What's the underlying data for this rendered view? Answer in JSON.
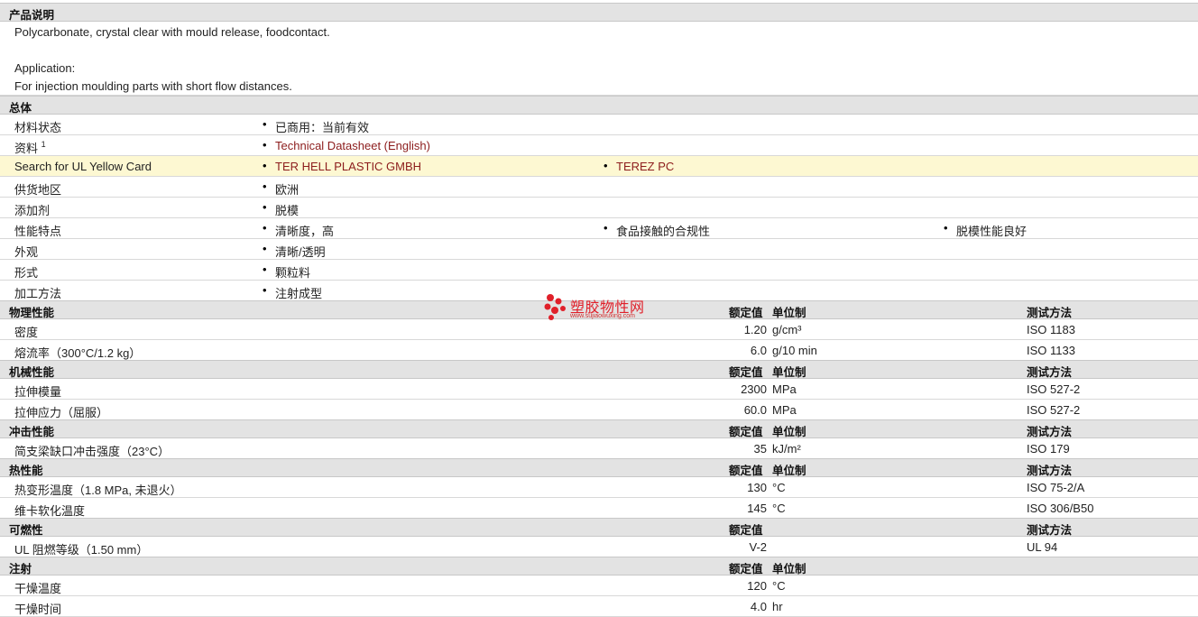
{
  "section_desc": {
    "title": "产品说明",
    "line1": "Polycarbonate, crystal clear with mould release, foodcontact.",
    "line2": "Application:",
    "line3": "For injection moulding parts with short flow distances."
  },
  "general": {
    "title": "总体",
    "rows": [
      {
        "label": "材料状态",
        "values": [
          "已商用：当前有效"
        ]
      },
      {
        "label": "资料",
        "sup": "1",
        "values": [
          "Technical Datasheet (English)"
        ]
      },
      {
        "label": "Search for UL Yellow Card",
        "values": [
          "TER HELL PLASTIC GMBH",
          "TEREZ PC"
        ]
      },
      {
        "label": "供货地区",
        "values": [
          "欧洲"
        ]
      },
      {
        "label": "添加剂",
        "values": [
          "脱模"
        ]
      },
      {
        "label": "性能特点",
        "values": [
          "清晰度，高",
          "食品接触的合规性",
          "脱模性能良好"
        ]
      },
      {
        "label": "外观",
        "values": [
          "清晰/透明"
        ]
      },
      {
        "label": "形式",
        "values": [
          "颗粒料"
        ]
      },
      {
        "label": "加工方法",
        "values": [
          "注射成型"
        ]
      }
    ]
  },
  "col_headers": {
    "value": "额定值",
    "unit": "单位制",
    "method": "测试方法"
  },
  "physical": {
    "title": "物理性能",
    "rows": [
      {
        "label": "密度",
        "value": "1.20",
        "unit": "g/cm³",
        "method": "ISO 1183"
      },
      {
        "label": "熔流率（300°C/1.2 kg）",
        "value": "6.0",
        "unit": "g/10 min",
        "method": "ISO 1133"
      }
    ]
  },
  "mechanical": {
    "title": "机械性能",
    "rows": [
      {
        "label": "拉伸模量",
        "value": "2300",
        "unit": "MPa",
        "method": "ISO 527-2"
      },
      {
        "label": "拉伸应力（屈服）",
        "value": "60.0",
        "unit": "MPa",
        "method": "ISO 527-2"
      }
    ]
  },
  "impact": {
    "title": "冲击性能",
    "rows": [
      {
        "label": "简支梁缺口冲击强度（23°C）",
        "value": "35",
        "unit": "kJ/m²",
        "method": "ISO 179"
      }
    ]
  },
  "thermal": {
    "title": "热性能",
    "rows": [
      {
        "label": "热变形温度（1.8 MPa, 未退火）",
        "value": "130",
        "unit": "°C",
        "method": "ISO 75-2/A"
      },
      {
        "label": "维卡软化温度",
        "value": "145",
        "unit": "°C",
        "method": "ISO 306/B50"
      }
    ]
  },
  "flammability": {
    "title": "可燃性",
    "rows": [
      {
        "label": "UL 阻燃等级（1.50 mm）",
        "value": "V-2",
        "unit": "",
        "method": "UL 94"
      }
    ]
  },
  "injection": {
    "title": "注射",
    "rows": [
      {
        "label": "干燥温度",
        "value": "120",
        "unit": "°C",
        "method": ""
      },
      {
        "label": "干燥时间",
        "value": "4.0",
        "unit": "hr",
        "method": ""
      }
    ]
  },
  "watermark": {
    "title": "塑胶物性网",
    "url": "www.sujiaowuxing.com",
    "color": "#e0202a"
  }
}
